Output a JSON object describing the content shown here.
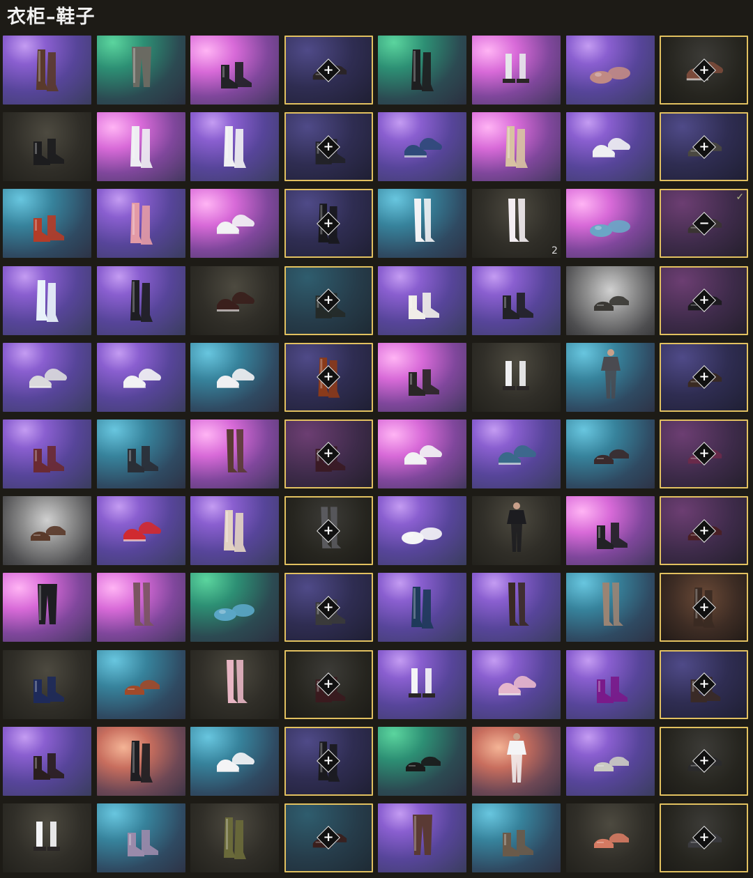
{
  "title": "衣柜–鞋子",
  "grid": {
    "cells": [
      {
        "bg": "violet",
        "shoe": "tall-boots",
        "color": "#5a3a2c"
      },
      {
        "bg": "green",
        "shoe": "pants",
        "color": "#6a6a62"
      },
      {
        "bg": "pink",
        "shoe": "ankle-boots",
        "color": "#222226"
      },
      {
        "bg": "dviolet",
        "selected": true,
        "shoe": "low-shoes",
        "color": "#2a2424",
        "action": "plus"
      },
      {
        "bg": "green",
        "shoe": "tall-boots",
        "color": "#1e1e20"
      },
      {
        "bg": "pink",
        "shoe": "socks-shoes",
        "color": "#e6e6ea"
      },
      {
        "bg": "violet",
        "shoe": "slippers",
        "color": "#c08a84"
      },
      {
        "bg": "dgrey",
        "selected": true,
        "shoe": "sneakers",
        "color": "#7a4a3a",
        "action": "plus"
      },
      {
        "bg": "dark",
        "shoe": "ankle-boots",
        "color": "#1c1c1e"
      },
      {
        "bg": "pink",
        "shoe": "tall-boots",
        "color": "#eeeef2"
      },
      {
        "bg": "violet",
        "shoe": "tall-boots",
        "color": "#f0f0f2"
      },
      {
        "bg": "dviolet",
        "selected": true,
        "shoe": "ankle-boots",
        "color": "#222228",
        "action": "plus"
      },
      {
        "bg": "violet",
        "shoe": "sneakers",
        "color": "#2f4a7a"
      },
      {
        "bg": "pink",
        "shoe": "tall-boots",
        "color": "#d8c2a2"
      },
      {
        "bg": "violet",
        "shoe": "sneakers",
        "color": "#efeff2"
      },
      {
        "bg": "dviolet",
        "selected": true,
        "shoe": "low-shoes",
        "color": "#4a4840",
        "action": "plus"
      },
      {
        "bg": "teal",
        "shoe": "ankle-boots",
        "color": "#b33c28"
      },
      {
        "bg": "violet",
        "shoe": "tall-boots",
        "color": "#e39aa6"
      },
      {
        "bg": "pink",
        "shoe": "sneakers",
        "color": "#f2f2f4"
      },
      {
        "bg": "dviolet",
        "selected": true,
        "shoe": "tall-boots",
        "color": "#18181c",
        "action": "plus"
      },
      {
        "bg": "teal",
        "shoe": "stockings",
        "color": "#f3f3f5"
      },
      {
        "bg": "dark",
        "shoe": "stockings",
        "color": "#f4eef2",
        "count": "2"
      },
      {
        "bg": "pink",
        "shoe": "slippers",
        "color": "#6aa6c6"
      },
      {
        "bg": "dpink",
        "selected": true,
        "shoe": "low-shoes",
        "color": "#3a3432",
        "action": "minus",
        "checked": true
      },
      {
        "bg": "violet",
        "shoe": "tall-boots",
        "color": "#e8f2fa"
      },
      {
        "bg": "violet",
        "shoe": "tall-boots",
        "color": "#1e1e22"
      },
      {
        "bg": "dark",
        "shoe": "sneakers",
        "color": "#3a1f1c"
      },
      {
        "bg": "dteal",
        "selected": true,
        "shoe": "ankle-boots",
        "color": "#242a28",
        "action": "plus"
      },
      {
        "bg": "violet",
        "shoe": "ankle-boots",
        "color": "#f0eee8"
      },
      {
        "bg": "violet",
        "shoe": "ankle-boots",
        "color": "#222226"
      },
      {
        "bg": "grey",
        "shoe": "low-shoes",
        "color": "#3a3834"
      },
      {
        "bg": "dpink",
        "selected": true,
        "shoe": "low-shoes",
        "color": "#1a1a1c",
        "action": "plus"
      },
      {
        "bg": "violet",
        "shoe": "sneakers",
        "color": "#dadadc"
      },
      {
        "bg": "violet",
        "shoe": "sneakers",
        "color": "#f2f2f4"
      },
      {
        "bg": "teal",
        "shoe": "sneakers",
        "color": "#f0f0f2"
      },
      {
        "bg": "dviolet",
        "selected": true,
        "shoe": "tall-boots",
        "color": "#8a3a1a",
        "action": "plus"
      },
      {
        "bg": "pink",
        "shoe": "ankle-boots",
        "color": "#2a2626"
      },
      {
        "bg": "dark",
        "shoe": "socks-shoes",
        "color": "#f0f0f2"
      },
      {
        "bg": "teal",
        "shoe": "outfit",
        "color": "#4a4a50"
      },
      {
        "bg": "dviolet",
        "selected": true,
        "shoe": "low-shoes",
        "color": "#3a2a22",
        "action": "plus"
      },
      {
        "bg": "violet",
        "shoe": "ankle-boots",
        "color": "#6a2a32"
      },
      {
        "bg": "teal",
        "shoe": "ankle-boots",
        "color": "#2a2e36"
      },
      {
        "bg": "pink",
        "shoe": "stockings",
        "color": "#5a3a34"
      },
      {
        "bg": "dpink",
        "selected": true,
        "shoe": "ankle-boots",
        "color": "#3a1a24",
        "action": "plus"
      },
      {
        "bg": "pink",
        "shoe": "sneakers",
        "color": "#f2f2f4"
      },
      {
        "bg": "violet",
        "shoe": "sneakers",
        "color": "#3a6a8a"
      },
      {
        "bg": "teal",
        "shoe": "low-shoes",
        "color": "#3a2a2c"
      },
      {
        "bg": "dpink",
        "selected": true,
        "shoe": "low-shoes",
        "color": "#6a2a4a",
        "action": "plus"
      },
      {
        "bg": "grey",
        "shoe": "low-shoes",
        "color": "#5a3a2a"
      },
      {
        "bg": "violet",
        "shoe": "sneakers",
        "color": "#d02a30"
      },
      {
        "bg": "violet",
        "shoe": "tall-boots",
        "color": "#e2d2c2"
      },
      {
        "bg": "dgrey",
        "selected": true,
        "shoe": "stockings",
        "color": "#5a5a5e",
        "action": "plus"
      },
      {
        "bg": "violet",
        "shoe": "slippers",
        "color": "#f4f4f6"
      },
      {
        "bg": "dark",
        "shoe": "outfit",
        "color": "#1c1c20"
      },
      {
        "bg": "pink",
        "shoe": "ankle-boots",
        "color": "#222226"
      },
      {
        "bg": "dpink",
        "selected": true,
        "shoe": "low-shoes",
        "color": "#4a1e22",
        "action": "plus"
      },
      {
        "bg": "pink",
        "shoe": "pants",
        "color": "#1e1e22"
      },
      {
        "bg": "pink",
        "shoe": "stockings",
        "color": "#7a5460"
      },
      {
        "bg": "green",
        "shoe": "slippers",
        "color": "#5aa6c6"
      },
      {
        "bg": "dviolet",
        "selected": true,
        "shoe": "ankle-boots",
        "color": "#3a3a3a",
        "action": "plus"
      },
      {
        "bg": "violet",
        "shoe": "tall-boots",
        "color": "#1e3a5a"
      },
      {
        "bg": "violet",
        "shoe": "stockings",
        "color": "#3a2a24"
      },
      {
        "bg": "teal",
        "shoe": "stockings",
        "color": "#9a8474"
      },
      {
        "bg": "brown",
        "selected": true,
        "shoe": "tall-boots",
        "color": "#3a2a22",
        "action": "plus"
      },
      {
        "bg": "dark",
        "shoe": "ankle-boots",
        "color": "#1e2a5a"
      },
      {
        "bg": "teal",
        "shoe": "low-shoes",
        "color": "#a04a2a"
      },
      {
        "bg": "dark",
        "shoe": "stockings",
        "color": "#e8b6c4"
      },
      {
        "bg": "dgrey",
        "selected": true,
        "shoe": "ankle-boots",
        "color": "#3a1a1e",
        "action": "plus"
      },
      {
        "bg": "violet",
        "shoe": "socks-shoes",
        "color": "#f4f4f6"
      },
      {
        "bg": "violet",
        "shoe": "sneakers",
        "color": "#e6b6cc"
      },
      {
        "bg": "violet",
        "shoe": "ankle-boots",
        "color": "#7a1a8a"
      },
      {
        "bg": "dviolet",
        "selected": true,
        "shoe": "ankle-boots",
        "color": "#3a2a26",
        "action": "plus"
      },
      {
        "bg": "violet",
        "shoe": "ankle-boots",
        "color": "#2a1e1e"
      },
      {
        "bg": "orange",
        "shoe": "tall-boots",
        "color": "#1e1e22"
      },
      {
        "bg": "teal",
        "shoe": "sneakers",
        "color": "#f4f4f6"
      },
      {
        "bg": "dviolet",
        "selected": true,
        "shoe": "tall-boots",
        "color": "#1a1a1e",
        "action": "plus"
      },
      {
        "bg": "green",
        "shoe": "low-shoes",
        "color": "#1a1a1a"
      },
      {
        "bg": "orange",
        "shoe": "outfit",
        "color": "#f4f4f6"
      },
      {
        "bg": "violet",
        "shoe": "low-shoes",
        "color": "#cacac2"
      },
      {
        "bg": "dgrey",
        "selected": true,
        "shoe": "low-shoes",
        "color": "#2a2a2c",
        "action": "plus"
      },
      {
        "bg": "dark",
        "shoe": "socks-shoes",
        "color": "#f4f4f6"
      },
      {
        "bg": "teal",
        "shoe": "ankle-boots",
        "color": "#9a8aaa"
      },
      {
        "bg": "dark",
        "shoe": "tall-boots",
        "color": "#6a6a3a"
      },
      {
        "bg": "dteal",
        "selected": true,
        "shoe": "low-shoes",
        "color": "#3a1e1c",
        "action": "plus"
      },
      {
        "bg": "violet",
        "shoe": "pants",
        "color": "#5a3a34"
      },
      {
        "bg": "teal",
        "shoe": "ankle-boots",
        "color": "#6a5a4a"
      },
      {
        "bg": "dark",
        "shoe": "low-shoes",
        "color": "#d47a62"
      },
      {
        "bg": "dgrey",
        "selected": true,
        "shoe": "low-shoes",
        "color": "#3a3a3e",
        "action": "plus"
      }
    ]
  }
}
